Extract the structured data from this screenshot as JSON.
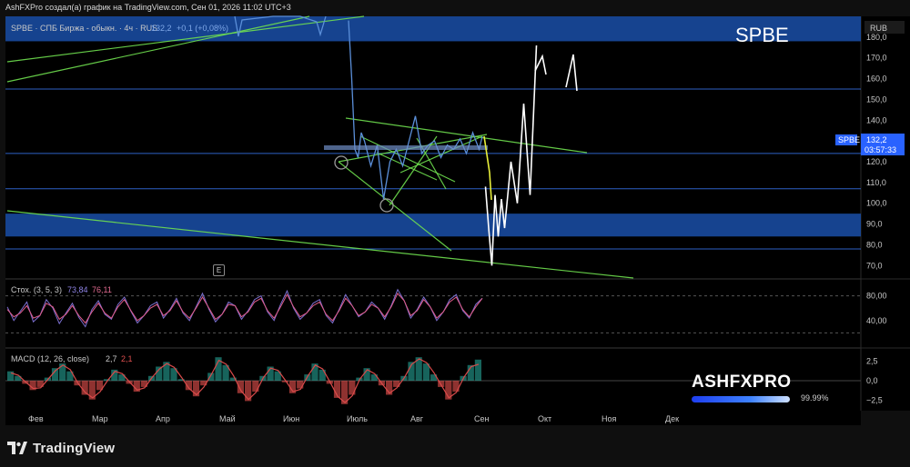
{
  "header": {
    "attribution": "AshFXPro создал(а) график на TradingView.com, Сен 01, 2026 11:02 UTC+3"
  },
  "legend": {
    "symbol_line": "SPBE · СПБ Биржа - обыкн. · 4ч · RUS",
    "last_value": "132,2",
    "change": "+0,1 (+0,08%)"
  },
  "watermark": {
    "ticker": "SPBE"
  },
  "price_axis": {
    "currency": "RUB",
    "ticker_tag": "SPBE",
    "last_price": "132,2",
    "countdown": "03:57:33"
  },
  "event_marker": {
    "label": "E"
  },
  "branding": {
    "overlay_name": "ASHFXPRO",
    "overlay_percent": "99.99%",
    "overlay_fill": 0.9999,
    "footer": "TradingView"
  },
  "colors": {
    "background": "#000000",
    "price_line": "#5b8fd9",
    "projection": "#ffffff",
    "trendline": "#6fe04f",
    "zone_fill": "#1a4fa8",
    "stoch_k": "#7b6fd0",
    "stoch_d": "#e05c8a",
    "macd_line": "#d94a4a",
    "hist_pos": "#26a69a",
    "hist_neg": "#ef5350"
  },
  "chart_data": [
    {
      "type": "line",
      "name": "price",
      "x_axis_labels": [
        "Фев",
        "Мар",
        "Апр",
        "Май",
        "Июн",
        "Июль",
        "Авг",
        "Сен",
        "Окт",
        "Ноя",
        "Дек"
      ],
      "y_ticks": [
        "70,0",
        "80,0",
        "90,0",
        "100,0",
        "110,0",
        "120,0",
        "130,0",
        "140,0",
        "150,0",
        "160,0",
        "170,0",
        "180,0"
      ],
      "ylim": [
        64,
        190
      ],
      "series": [
        {
          "x": [
            4.9,
            4.95,
            5.0,
            5.05,
            5.1,
            5.15,
            5.25,
            5.35,
            5.45,
            5.55,
            5.65,
            5.75,
            5.85,
            5.95,
            6.05,
            6.15,
            6.25,
            6.35,
            6.45,
            6.55,
            6.65,
            6.75,
            6.85,
            6.95,
            7.0
          ],
          "values": [
            188,
            160,
            126,
            122,
            134,
            130,
            118,
            128,
            102,
            120,
            126,
            118,
            130,
            142,
            124,
            128,
            130,
            122,
            128,
            126,
            131,
            124,
            134,
            126,
            132.2
          ]
        }
      ],
      "projection": {
        "x": [
          7.05,
          7.1,
          7.15,
          7.2,
          7.25,
          7.3,
          7.35,
          7.45,
          7.55,
          7.65,
          7.75,
          7.85
        ],
        "values": [
          108,
          88,
          70,
          104,
          84,
          102,
          88,
          120,
          100,
          148,
          104,
          176
        ]
      },
      "zones": [
        [
          84,
          95
        ],
        [
          178,
          190
        ]
      ],
      "levels": [
        155,
        124,
        107,
        78
      ]
    },
    {
      "type": "line",
      "title": "Стох. (3, 5, 3)",
      "values_shown": [
        "73,84",
        "76,11"
      ],
      "y_ticks": [
        "80,00",
        "40,00"
      ],
      "ylim": [
        0,
        100
      ],
      "bands": [
        80,
        20
      ],
      "series": [
        {
          "values": [
            62,
            40,
            55,
            70,
            38,
            48,
            74,
            60,
            35,
            52,
            68,
            45,
            30,
            58,
            72,
            50,
            42,
            66,
            78,
            55,
            36,
            48,
            64,
            70,
            44,
            58,
            76,
            52,
            40,
            62,
            84,
            58,
            38,
            50,
            70,
            64,
            42,
            56,
            74,
            80,
            54,
            40,
            66,
            88,
            60,
            42,
            52,
            68,
            74,
            48,
            36,
            58,
            82,
            64,
            46,
            54,
            70,
            60,
            42,
            64,
            90,
            72,
            44,
            58,
            78,
            62,
            40,
            54,
            74,
            82,
            56,
            44,
            66,
            76
          ]
        },
        {
          "values": [
            58,
            46,
            52,
            64,
            44,
            48,
            68,
            62,
            42,
            50,
            64,
            48,
            36,
            54,
            68,
            52,
            44,
            62,
            74,
            56,
            40,
            48,
            60,
            66,
            48,
            56,
            72,
            54,
            44,
            60,
            78,
            60,
            42,
            50,
            66,
            64,
            46,
            54,
            70,
            76,
            56,
            44,
            62,
            82,
            62,
            46,
            52,
            64,
            70,
            50,
            40,
            56,
            76,
            64,
            48,
            54,
            66,
            60,
            46,
            62,
            84,
            72,
            48,
            56,
            74,
            62,
            44,
            54,
            70,
            78,
            58,
            46,
            62,
            76
          ]
        }
      ]
    },
    {
      "type": "bar",
      "title": "MACD (12, 26, close)",
      "values_shown": [
        "2,7",
        "2,1"
      ],
      "y_ticks": [
        "2,5",
        "0,0",
        "−2,5"
      ],
      "ylim": [
        -3.6,
        3.6
      ],
      "series": [
        {
          "name": "histogram",
          "values": [
            1.2,
            0.6,
            -0.4,
            -1.2,
            -0.8,
            0.4,
            1.6,
            2.2,
            1.2,
            -0.6,
            -1.8,
            -2.4,
            -1.2,
            0.2,
            1.4,
            0.8,
            -0.4,
            -1.4,
            -0.8,
            0.6,
            1.8,
            2.4,
            1.6,
            0.2,
            -1.2,
            -2.0,
            -0.6,
            1.0,
            3.0,
            2.0,
            0.4,
            -1.6,
            -2.6,
            -1.4,
            0.6,
            1.8,
            1.2,
            -0.2,
            -1.6,
            -1.0,
            0.8,
            2.2,
            1.4,
            -0.4,
            -2.2,
            -3.0,
            -1.8,
            0.4,
            1.6,
            0.8,
            -0.6,
            -1.8,
            -0.8,
            0.6,
            2.4,
            3.0,
            2.2,
            0.8,
            -0.8,
            -2.4,
            -1.4,
            0.6,
            2.0,
            2.7
          ]
        },
        {
          "name": "macd",
          "values": [
            1.0,
            0.7,
            -0.2,
            -1.0,
            -0.9,
            0.2,
            1.3,
            2.0,
            1.4,
            -0.3,
            -1.5,
            -2.2,
            -1.4,
            0.0,
            1.2,
            0.9,
            -0.2,
            -1.2,
            -0.9,
            0.4,
            1.5,
            2.2,
            1.7,
            0.4,
            -1.0,
            -1.8,
            -0.8,
            0.8,
            2.6,
            2.1,
            0.6,
            -1.3,
            -2.4,
            -1.5,
            0.4,
            1.6,
            1.3,
            0.0,
            -1.4,
            -1.1,
            0.6,
            2.0,
            1.5,
            -0.2,
            -2.0,
            -2.8,
            -1.9,
            0.2,
            1.4,
            0.9,
            -0.4,
            -1.6,
            -0.9,
            0.4,
            2.1,
            2.8,
            2.3,
            1.0,
            -0.6,
            -2.2,
            -1.5,
            0.4,
            1.8,
            2.1
          ]
        }
      ]
    }
  ]
}
